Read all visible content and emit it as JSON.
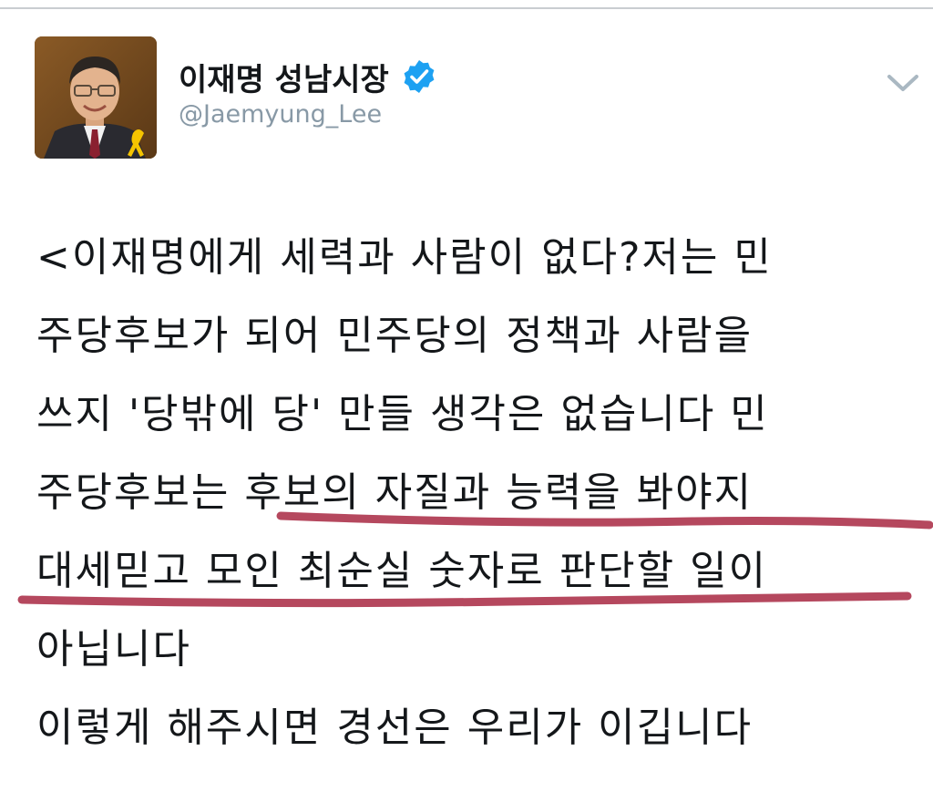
{
  "account": {
    "display_name": "이재명 성남시장",
    "handle": "@Jaemyung_Lee",
    "verified": true
  },
  "icons": {
    "verified": "verified-badge-icon",
    "menu": "chevron-down-icon",
    "avatar": "profile-photo"
  },
  "tweet": {
    "lines": [
      "<이재명에게 세력과 사람이 없다?저는 민",
      "주당후보가 되어 민주당의 정책과 사람을",
      "쓰지 '당밖에 당' 만들 생각은 없습니다 민",
      "주당후보는 후보의 자질과 능력을 봐야지",
      "대세믿고 모인 최순실 숫자로 판단할 일이",
      "아닙니다",
      "이렇게 해주시면 경선은 우리가 이깁니다"
    ]
  },
  "colors": {
    "verified_blue": "#1da1f2",
    "handle_gray": "#8899a6",
    "underline_red": "#b5485e",
    "text": "#14171a"
  }
}
